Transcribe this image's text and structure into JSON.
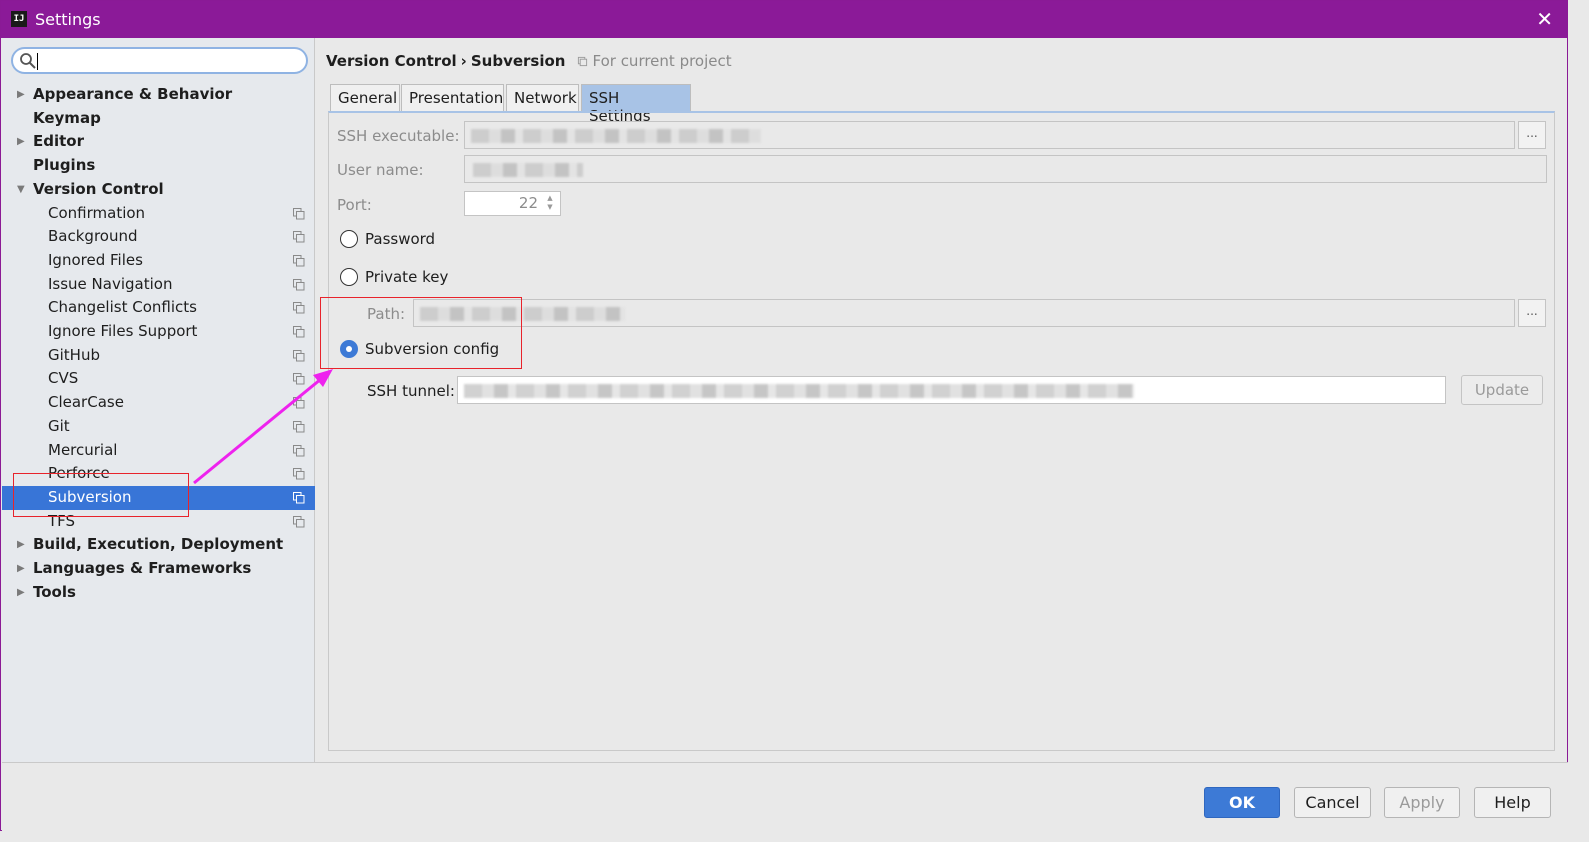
{
  "window": {
    "title": "Settings",
    "app_icon_text": "IJ",
    "close_glyph": "✕"
  },
  "sidebar": {
    "search": {
      "value": "",
      "placeholder": ""
    },
    "items": [
      {
        "label": "Appearance & Behavior",
        "level": "top",
        "arrow": "▶"
      },
      {
        "label": "Keymap",
        "level": "top",
        "arrow": ""
      },
      {
        "label": "Editor",
        "level": "top",
        "arrow": "▶"
      },
      {
        "label": "Plugins",
        "level": "top",
        "arrow": ""
      },
      {
        "label": "Version Control",
        "level": "top",
        "arrow": "▼"
      },
      {
        "label": "Confirmation",
        "level": "child"
      },
      {
        "label": "Background",
        "level": "child"
      },
      {
        "label": "Ignored Files",
        "level": "child"
      },
      {
        "label": "Issue Navigation",
        "level": "child"
      },
      {
        "label": "Changelist Conflicts",
        "level": "child"
      },
      {
        "label": "Ignore Files Support",
        "level": "child"
      },
      {
        "label": "GitHub",
        "level": "child"
      },
      {
        "label": "CVS",
        "level": "child"
      },
      {
        "label": "ClearCase",
        "level": "child"
      },
      {
        "label": "Git",
        "level": "child"
      },
      {
        "label": "Mercurial",
        "level": "child"
      },
      {
        "label": "Perforce",
        "level": "child"
      },
      {
        "label": "Subversion",
        "level": "child",
        "selected": true
      },
      {
        "label": "TFS",
        "level": "child"
      },
      {
        "label": "Build, Execution, Deployment",
        "level": "top",
        "arrow": "▶"
      },
      {
        "label": "Languages & Frameworks",
        "level": "top",
        "arrow": "▶"
      },
      {
        "label": "Tools",
        "level": "top",
        "arrow": "▶"
      }
    ]
  },
  "breadcrumb": {
    "parent": "Version Control",
    "separator": "›",
    "current": "Subversion",
    "scope": "For current project"
  },
  "tabs": [
    {
      "label": "General",
      "active": false
    },
    {
      "label": "Presentation",
      "active": false
    },
    {
      "label": "Network",
      "active": false
    },
    {
      "label": "SSH Settings",
      "active": true
    }
  ],
  "ssh": {
    "executable_label": "SSH executable:",
    "username_label": "User name:",
    "port_label": "Port:",
    "port_value": "22",
    "password_label": "Password",
    "private_key_label": "Private key",
    "path_label": "Path:",
    "subversion_config_label": "Subversion config",
    "tunnel_label": "SSH tunnel:",
    "update_label": "Update",
    "browse_glyph": "...",
    "selected_auth": "Subversion config"
  },
  "footer": {
    "ok": "OK",
    "cancel": "Cancel",
    "apply": "Apply",
    "help": "Help"
  },
  "colors": {
    "titlebar": "#8b1a98",
    "selection": "#3875d7",
    "annotation_box": "#e8232b",
    "annotation_arrow": "#ee22ee",
    "primary_button": "#3d7ad6"
  }
}
